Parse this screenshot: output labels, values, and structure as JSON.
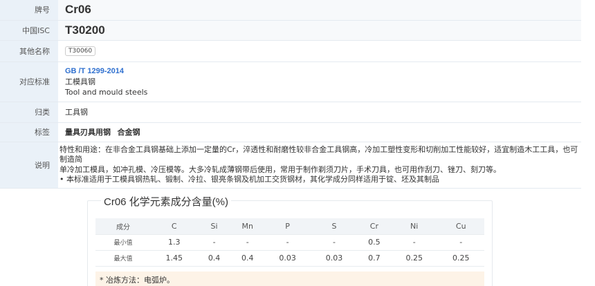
{
  "info": {
    "brand_label": "牌号",
    "brand_value": "Cr06",
    "isc_label": "中国ISC",
    "isc_value": "T30200",
    "alias_label": "其他名称",
    "alias_value": "T30060",
    "std_label": "对应标准",
    "std_link": "GB /T 1299-2014",
    "std_cn": "工模具钢",
    "std_en": "Tool and mould steels",
    "class_label": "归类",
    "class_value": "工具钢",
    "tags_label": "标签",
    "tags": [
      "量具刃具用钢",
      "合金钢"
    ],
    "desc_label": "说明",
    "desc_line1": "特性和用途：在非合金工具钢基础上添加一定量的Cr，淬透性和耐磨性较非合金工具钢高，冷加工塑性变形和切削加工性能较好，适宜制造木工工具，也可制造简",
    "desc_line2": "单冷加工模具，如冲孔模、冷压模等。大多冷轧成薄钢带后使用，常用于制作剃须刀片，手术刀具，也可用作刮刀、锉刀、刻刀等。",
    "desc_line3": "• 本标准适用于工模具钢热轧、锻制、冷拉、银亮条钢及机加工交货钢材，其化学成分同样适用于锭、坯及其制品"
  },
  "composition": {
    "title": "Cr06 化学元素成分含量(%)",
    "header": [
      "成分",
      "C",
      "Si",
      "Mn",
      "P",
      "S",
      "Cr",
      "Ni",
      "Cu"
    ],
    "min_row": [
      "最小值",
      "1.3",
      "-",
      "-",
      "-",
      "-",
      "0.5",
      "-",
      "-"
    ],
    "max_row": [
      "最大值",
      "1.45",
      "0.4",
      "0.4",
      "0.03",
      "0.03",
      "0.7",
      "0.25",
      "0.25"
    ],
    "note": "* 冶炼方法：电弧炉。"
  }
}
